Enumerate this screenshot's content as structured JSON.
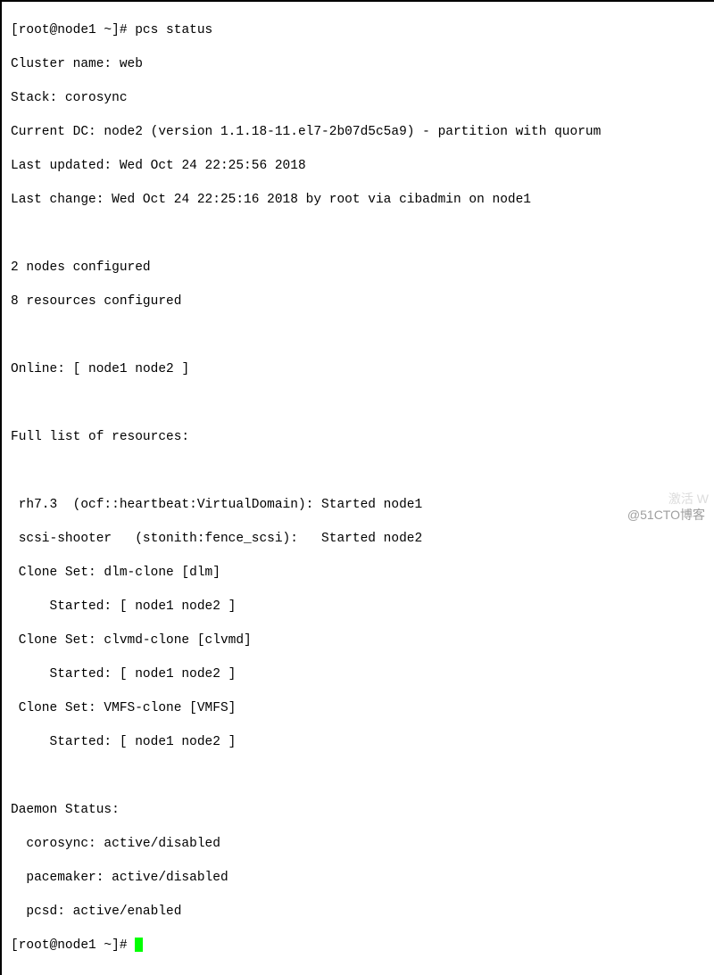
{
  "prompt1": "[root@node1 ~]# ",
  "command": "pcs status",
  "cluster_name_label": "Cluster name: ",
  "cluster_name": "web",
  "stack_label": "Stack: ",
  "stack": "corosync",
  "current_dc_label": "Current DC: ",
  "current_dc": "node2 (version 1.1.18-11.el7-2b07d5c5a9) - partition with quorum",
  "last_updated_label": "Last updated: ",
  "last_updated": "Wed Oct 24 22:25:56 2018",
  "last_change_label": "Last change: ",
  "last_change": "Wed Oct 24 22:25:16 2018 by root via cibadmin on node1",
  "nodes_configured": "2 nodes configured",
  "resources_configured": "8 resources configured",
  "online_label": "Online: ",
  "online": "[ node1 node2 ]",
  "full_list_header": "Full list of resources:",
  "resources": {
    "r1": " rh7.3  (ocf::heartbeat:VirtualDomain): Started node1",
    "r2": " scsi-shooter   (stonith:fence_scsi):   Started node2",
    "c1_header": " Clone Set: dlm-clone [dlm]",
    "c1_started": "     Started: [ node1 node2 ]",
    "c2_header": " Clone Set: clvmd-clone [clvmd]",
    "c2_started": "     Started: [ node1 node2 ]",
    "c3_header": " Clone Set: VMFS-clone [VMFS]",
    "c3_started": "     Started: [ node1 node2 ]"
  },
  "daemon_status_header": "Daemon Status:",
  "daemons": {
    "corosync": "  corosync: active/disabled",
    "pacemaker": "  pacemaker: active/disabled",
    "pcsd": "  pcsd: active/enabled"
  },
  "prompt2": "[root@node1 ~]# ",
  "watermark": "@51CTO博客",
  "faded_corner": "激活 W"
}
